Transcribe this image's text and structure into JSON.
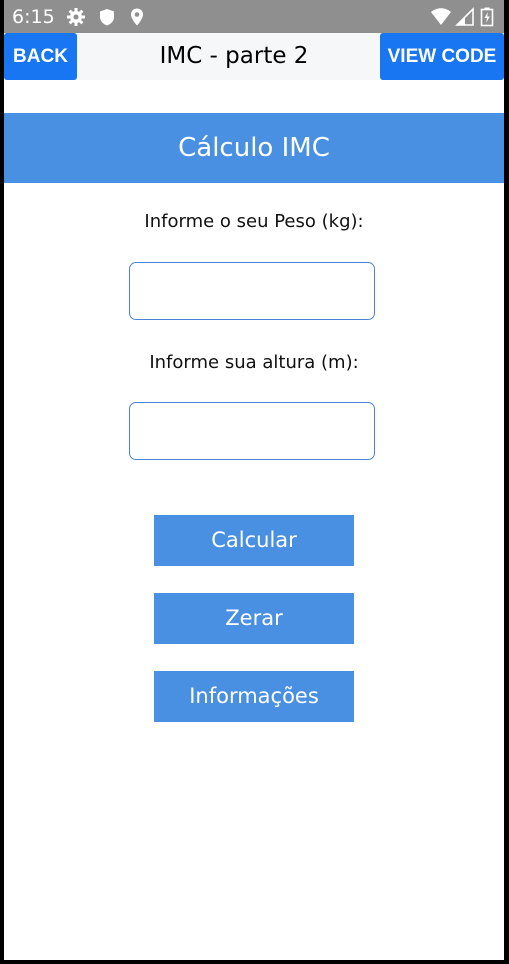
{
  "status_bar": {
    "time": "6:15",
    "icons": [
      "gear-icon",
      "shield-icon",
      "location-pin-icon",
      "wifi-icon",
      "signal-icon",
      "battery-icon"
    ],
    "background": "#8f8f8f"
  },
  "header": {
    "back_label": "BACK",
    "title": "IMC - parte 2",
    "view_code_label": "VIEW CODE",
    "button_color": "#1976f2"
  },
  "banner": {
    "title": "Cálculo IMC",
    "color": "#4a90e2"
  },
  "form": {
    "peso_label": "Informe o seu Peso (kg):",
    "peso_value": "",
    "altura_label": "Informe sua altura (m):",
    "altura_value": ""
  },
  "actions": {
    "calcular_label": "Calcular",
    "zerar_label": "Zerar",
    "info_label": "Informações",
    "color": "#4a90e2"
  }
}
